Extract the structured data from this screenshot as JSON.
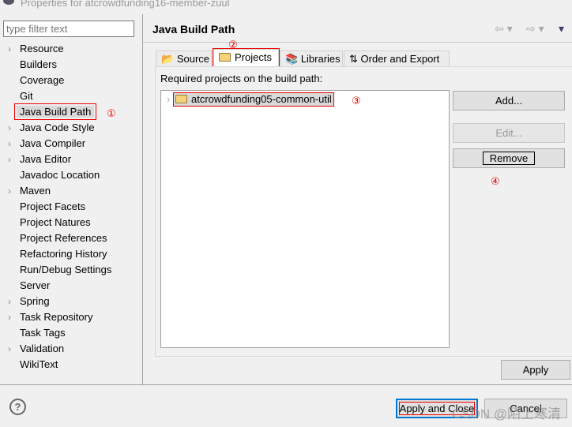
{
  "window": {
    "title": "Properties for atcrowdfunding16-member-zuul"
  },
  "sidebar": {
    "filter_placeholder": "type filter text",
    "items": [
      {
        "label": "Resource",
        "expandable": true
      },
      {
        "label": "Builders",
        "expandable": false
      },
      {
        "label": "Coverage",
        "expandable": false
      },
      {
        "label": "Git",
        "expandable": false
      },
      {
        "label": "Java Build Path",
        "expandable": false,
        "selected": true
      },
      {
        "label": "Java Code Style",
        "expandable": true
      },
      {
        "label": "Java Compiler",
        "expandable": true
      },
      {
        "label": "Java Editor",
        "expandable": true
      },
      {
        "label": "Javadoc Location",
        "expandable": false
      },
      {
        "label": "Maven",
        "expandable": true
      },
      {
        "label": "Project Facets",
        "expandable": false
      },
      {
        "label": "Project Natures",
        "expandable": false
      },
      {
        "label": "Project References",
        "expandable": false
      },
      {
        "label": "Refactoring History",
        "expandable": false
      },
      {
        "label": "Run/Debug Settings",
        "expandable": false
      },
      {
        "label": "Server",
        "expandable": false
      },
      {
        "label": "Spring",
        "expandable": true
      },
      {
        "label": "Task Repository",
        "expandable": true
      },
      {
        "label": "Task Tags",
        "expandable": false
      },
      {
        "label": "Validation",
        "expandable": true
      },
      {
        "label": "WikiText",
        "expandable": false
      }
    ]
  },
  "page": {
    "title": "Java Build Path",
    "tabs": [
      {
        "label": "Source"
      },
      {
        "label": "Projects",
        "active": true
      },
      {
        "label": "Libraries"
      },
      {
        "label": "Order and Export"
      }
    ],
    "required_label": "Required projects on the build path:",
    "projects": [
      "atcrowdfunding05-common-util"
    ],
    "buttons": {
      "add": "Add...",
      "edit": "Edit...",
      "remove": "Remove",
      "apply": "Apply"
    }
  },
  "annotations": {
    "a1": "①",
    "a2": "②",
    "a3": "③",
    "a4": "④"
  },
  "footer": {
    "help": "?",
    "apply_close": "Apply and Close",
    "cancel": "Cancel"
  },
  "watermark": "CSDN @陌上寒清",
  "colors": {
    "annotation": "#e00000",
    "focus": "#0078d7"
  }
}
